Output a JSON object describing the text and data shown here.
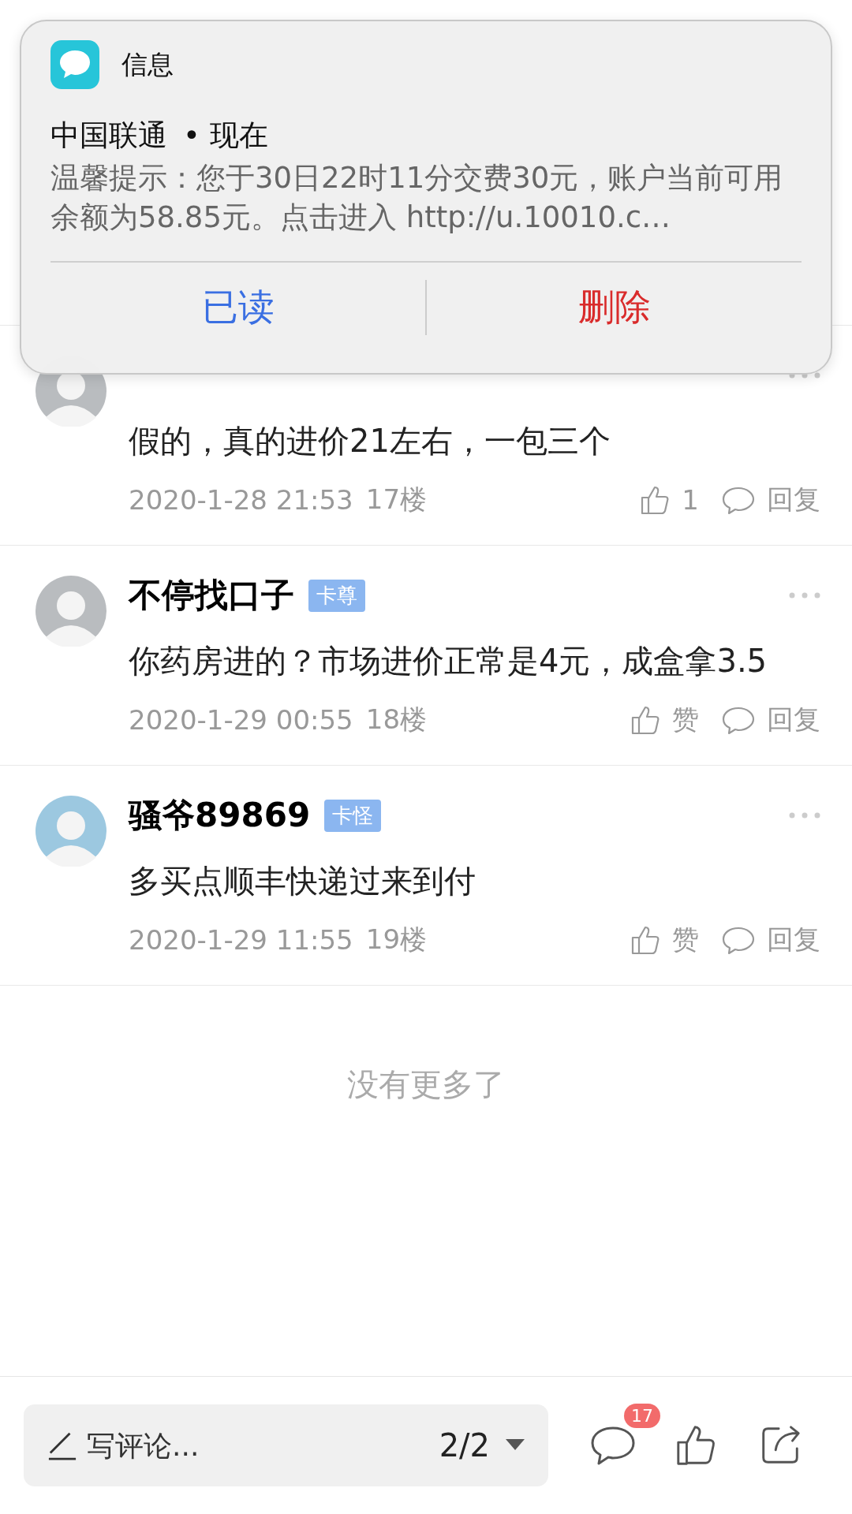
{
  "notification": {
    "app_name": "信息",
    "sender": "中国联通",
    "separator": "•",
    "time": "现在",
    "body": "温馨提示：您于30日22时11分交费30元，账户当前可用余额为58.85元。点击进入 http://u.10010.c…",
    "actions": [
      {
        "label": "已读",
        "kind": "normal"
      },
      {
        "label": "删除",
        "kind": "destructive"
      }
    ]
  },
  "comments": [
    {
      "text": "假的，真的进价21左右，一包三个",
      "date": "2020-1-28 21:53",
      "floor": "17楼",
      "like_label": "1",
      "reply_label": "回复"
    },
    {
      "name": "不停找口子",
      "badge": "卡尊",
      "text": "你药房进的？市场进价正常是4元，成盒拿3.5",
      "date": "2020-1-29 00:55",
      "floor": "18楼",
      "like_label": "赞",
      "reply_label": "回复"
    },
    {
      "name": "骚爷89869",
      "badge": "卡怪",
      "text": "多买点顺丰快递过来到付",
      "date": "2020-1-29 11:55",
      "floor": "19楼",
      "like_label": "赞",
      "reply_label": "回复"
    }
  ],
  "end_text": "没有更多了",
  "bottom_bar": {
    "placeholder": "写评论...",
    "page": "2/2",
    "comment_count": "17"
  }
}
